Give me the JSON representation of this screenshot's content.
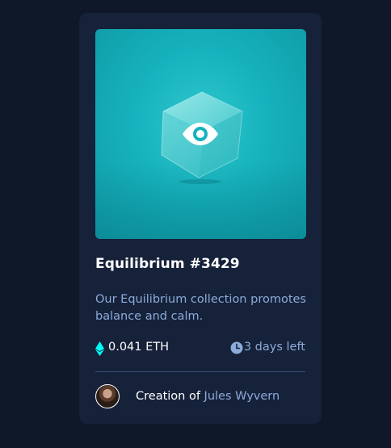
{
  "card": {
    "title": "Equilibrium #3429",
    "description": "Our Equilibrium collection promotes balance and calm.",
    "price": "0.041 ETH",
    "time_left": "3 days left",
    "creator_prefix": "Creation of",
    "creator_name": "Jules Wyvern"
  },
  "icons": {
    "media_overlay": "eye-icon",
    "price": "ethereum-icon",
    "time": "clock-icon",
    "avatar": "avatar"
  },
  "colors": {
    "page_background": "#0f1828",
    "card_background": "#16213a",
    "accent_cyan": "#00fff8",
    "soft_blue": "#8bacd9",
    "white": "#ffffff"
  }
}
